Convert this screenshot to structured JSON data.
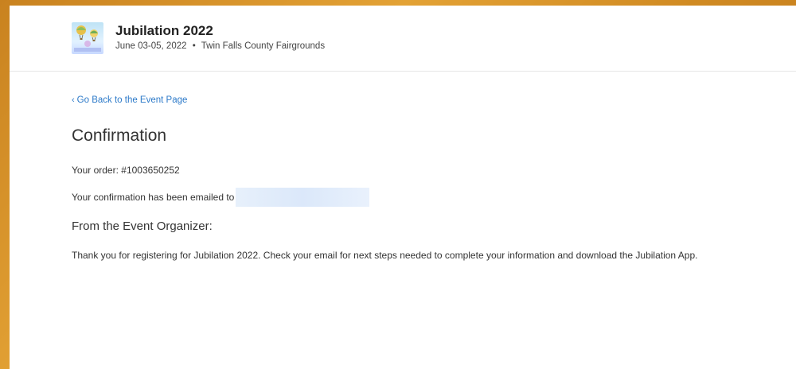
{
  "event": {
    "name": "Jubilation 2022",
    "dates": "June 03-05, 2022",
    "separator": "•",
    "venue": "Twin Falls County Fairgrounds",
    "logo_icon": "hot-air-balloons-logo"
  },
  "navigation": {
    "back_label": "Go Back to the Event Page",
    "back_icon": "chevron-left-icon"
  },
  "confirmation": {
    "title": "Confirmation",
    "order_label": "Your order:",
    "order_number": "#1003650252",
    "emailed_text": "Your confirmation has been emailed to"
  },
  "organizer": {
    "heading": "From the Event Organizer:",
    "message": "Thank you for registering for Jubilation 2022. Check your email for next steps needed to complete your information and download the Jubilation App."
  },
  "colors": {
    "link": "#2d7ac9",
    "background_accent": "#d8922a",
    "text": "#333333"
  }
}
